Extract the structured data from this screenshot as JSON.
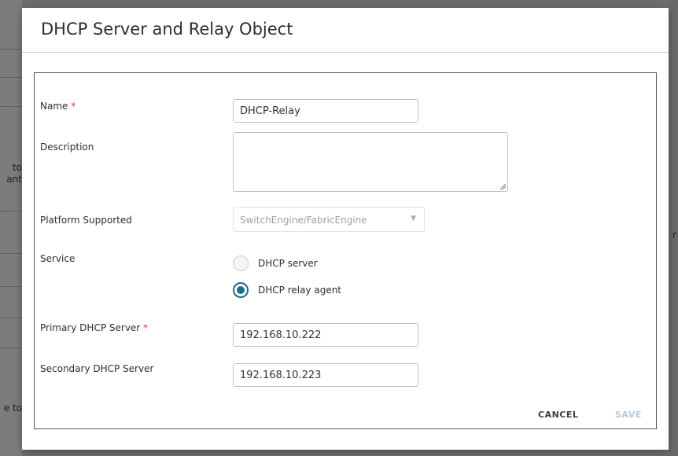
{
  "background": {
    "left_snippets": [
      "to",
      "ant",
      "e to"
    ],
    "right_snippet": "r"
  },
  "dialog": {
    "title": "DHCP Server and Relay Object",
    "required_marker": "*",
    "fields": {
      "name": {
        "label": "Name",
        "value": "DHCP-Relay"
      },
      "description": {
        "label": "Description",
        "value": ""
      },
      "platform": {
        "label": "Platform Supported",
        "selected": "SwitchEngine/FabricEngine"
      },
      "service": {
        "label": "Service",
        "options": [
          {
            "label": "DHCP server",
            "checked": false
          },
          {
            "label": "DHCP relay agent",
            "checked": true
          }
        ]
      },
      "primary_server": {
        "label": "Primary DHCP Server",
        "value": "192.168.10.222"
      },
      "secondary_server": {
        "label": "Secondary DHCP Server",
        "value": "192.168.10.223"
      }
    },
    "buttons": {
      "cancel": "CANCEL",
      "save": "SAVE"
    }
  },
  "colors": {
    "accent": "#1a6f86",
    "required": "#d9363e",
    "disabled_button": "#b4ccd8"
  }
}
